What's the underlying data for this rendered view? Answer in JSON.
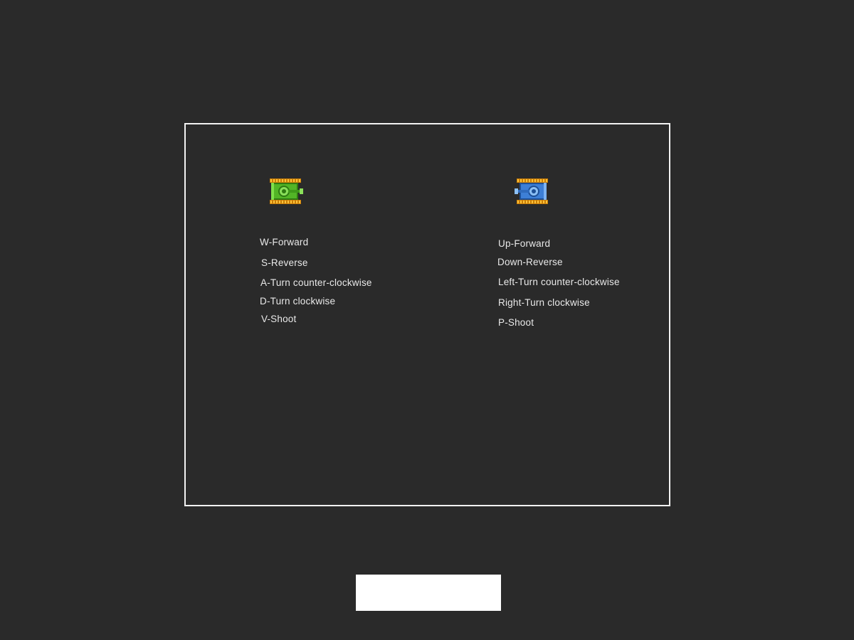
{
  "colors": {
    "background": "#2a2a2a",
    "panel_border": "#f2f2f2",
    "text": "#e9e9e9",
    "button": "#ffffff",
    "player1_tank": "#4caf1f",
    "player2_tank": "#3d7fd6",
    "tank_tracks": "#f0a010"
  },
  "player1": {
    "tank_icon": "green-tank-icon",
    "controls": [
      "W-Forward",
      "S-Reverse",
      "A-Turn counter-clockwise",
      "D-Turn clockwise",
      "V-Shoot"
    ]
  },
  "player2": {
    "tank_icon": "blue-tank-icon",
    "controls": [
      "Up-Forward",
      "Down-Reverse",
      "Left-Turn counter-clockwise",
      "Right-Turn clockwise",
      "P-Shoot"
    ]
  },
  "start_button": {
    "label": ""
  }
}
